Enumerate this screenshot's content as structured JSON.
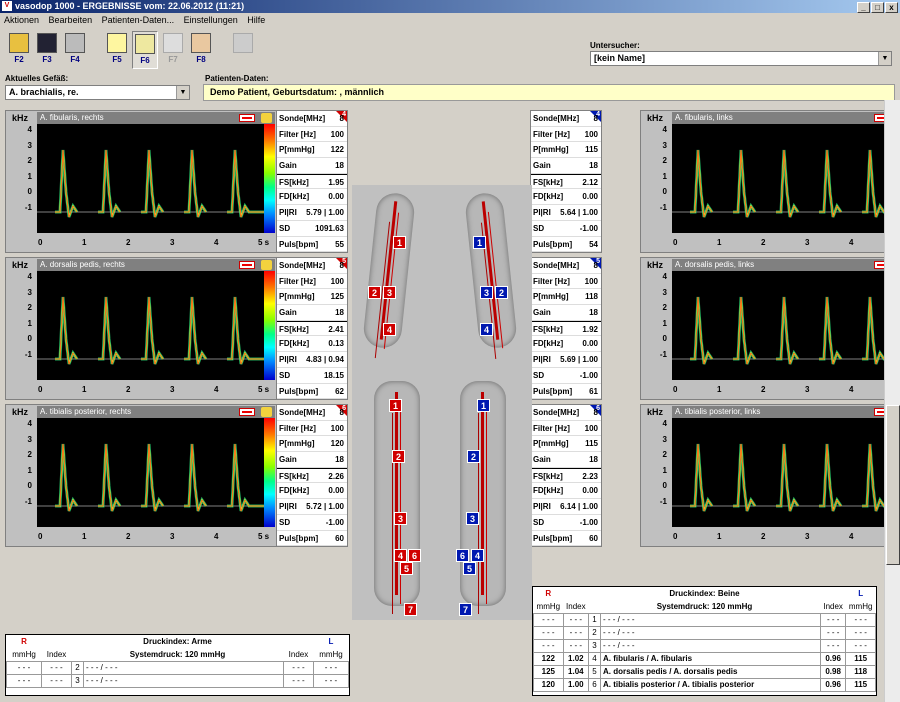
{
  "window": {
    "title": "vasodop 1000 - ERGEBNISSE vom: 22.06.2012 (11:21)",
    "app_icon": "V"
  },
  "window_buttons": {
    "min": "_",
    "max": "□",
    "close": "x"
  },
  "menu": [
    "Aktionen",
    "Bearbeiten",
    "Patienten-Daten...",
    "Einstellungen",
    "Hilfe"
  ],
  "toolbar": [
    {
      "key": "F2",
      "icon": "folder-open-icon"
    },
    {
      "key": "F3",
      "icon": "save-icon"
    },
    {
      "key": "F4",
      "icon": "print-icon"
    },
    {
      "key": "F5",
      "icon": "chart-icon"
    },
    {
      "key": "F6",
      "icon": "results-icon",
      "selected": true
    },
    {
      "key": "F7",
      "icon": "disabled-icon",
      "disabled": true
    },
    {
      "key": "F8",
      "icon": "patient-icon"
    },
    {
      "key": "",
      "icon": "help-icon",
      "disabled": true
    }
  ],
  "examiner": {
    "label": "Untersucher:",
    "value": "[kein Name]"
  },
  "vessel": {
    "label": "Aktuelles Gefäß:",
    "value": "A. brachialis, re."
  },
  "patient": {
    "label": "Patienten-Daten:",
    "value": "Demo Patient, Geburtsdatum: , männlich"
  },
  "axis": {
    "unit": "kHz",
    "yticks": [
      "4",
      "3",
      "2",
      "1",
      "0",
      "-1"
    ],
    "xticks": [
      "0",
      "1",
      "2",
      "3",
      "4",
      "5 s"
    ]
  },
  "param_labels": [
    "Sonde[MHz]",
    "Filter [Hz]",
    "P[mmHg]",
    "Gain",
    "FS[kHz]",
    "FD[kHz]",
    "PI|RI",
    "SD",
    "Puls[bpm]"
  ],
  "panels": [
    {
      "side": "R",
      "num": "4",
      "title": "A. fibularis, rechts",
      "values": [
        "8",
        "100",
        "122",
        "18",
        "1.95",
        "0.00",
        "5.79 | 1.00",
        "1091.63",
        "55"
      ]
    },
    {
      "side": "R",
      "num": "5",
      "title": "A. dorsalis pedis, rechts",
      "values": [
        "8",
        "100",
        "125",
        "18",
        "2.41",
        "0.13",
        "4.83 | 0.94",
        "18.15",
        "62"
      ]
    },
    {
      "side": "R",
      "num": "6",
      "title": "A. tibialis posterior, rechts",
      "values": [
        "8",
        "100",
        "120",
        "18",
        "2.26",
        "0.00",
        "5.72 | 1.00",
        "-1.00",
        "60"
      ]
    },
    {
      "side": "L",
      "num": "4",
      "title": "A. fibularis, links",
      "values": [
        "8",
        "100",
        "115",
        "18",
        "2.12",
        "0.00",
        "5.64 | 1.00",
        "-1.00",
        "54"
      ]
    },
    {
      "side": "L",
      "num": "5",
      "title": "A. dorsalis pedis, links",
      "values": [
        "8",
        "100",
        "118",
        "18",
        "1.92",
        "0.00",
        "5.69 | 1.00",
        "-1.00",
        "61"
      ]
    },
    {
      "side": "L",
      "num": "6",
      "title": "A. tibialis posterior, links",
      "values": [
        "8",
        "100",
        "115",
        "18",
        "2.23",
        "0.00",
        "6.14 | 1.00",
        "-1.00",
        "60"
      ]
    }
  ],
  "markers": {
    "arm_r": [
      "1",
      "2",
      "3",
      "4"
    ],
    "arm_l": [
      "1",
      "3",
      "2",
      "4"
    ],
    "leg_r": [
      "1",
      "2",
      "3",
      "4",
      "6",
      "5",
      "7"
    ],
    "leg_l": [
      "1",
      "2",
      "3",
      "6",
      "4",
      "5",
      "7"
    ]
  },
  "druck_arme": {
    "title": "Druckindex: Arme",
    "system": "Systemdruck: 120 mmHg",
    "R": "R",
    "L": "L",
    "mmhg": "mmHg",
    "index": "Index",
    "rows": [
      {
        "n": "2",
        "name": "- - - / - - -"
      },
      {
        "n": "3",
        "name": "- - - / - - -"
      }
    ],
    "dash": "- - -"
  },
  "druck_beine": {
    "title": "Druckindex: Beine",
    "system": "Systemdruck: 120 mmHg",
    "R": "R",
    "L": "L",
    "mmhg": "mmHg",
    "index": "Index",
    "rows": [
      {
        "rm": "- - -",
        "ri": "- - -",
        "n": "1",
        "name": "- - - / - - -",
        "li": "- - -",
        "lm": "- - -"
      },
      {
        "rm": "- - -",
        "ri": "- - -",
        "n": "2",
        "name": "- - - / - - -",
        "li": "- - -",
        "lm": "- - -"
      },
      {
        "rm": "- - -",
        "ri": "- - -",
        "n": "3",
        "name": "- - - / - - -",
        "li": "- - -",
        "lm": "- - -"
      },
      {
        "rm": "122",
        "ri": "1.02",
        "n": "4",
        "name": "A. fibularis / A. fibularis",
        "li": "0.96",
        "lm": "115"
      },
      {
        "rm": "125",
        "ri": "1.04",
        "n": "5",
        "name": "A. dorsalis pedis / A. dorsalis pedis",
        "li": "0.98",
        "lm": "118"
      },
      {
        "rm": "120",
        "ri": "1.00",
        "n": "6",
        "name": "A. tibialis posterior / A. tibialis posterior",
        "li": "0.96",
        "lm": "115"
      }
    ]
  },
  "colors": {
    "right": "#d00000",
    "left": "#0018b0",
    "title_bar": "#0a246a"
  }
}
